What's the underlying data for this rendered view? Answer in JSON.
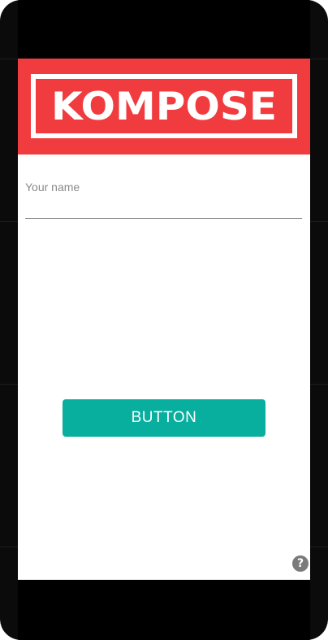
{
  "header": {
    "logo_text": "KOMPOSE",
    "background": "#f03c3e"
  },
  "form": {
    "name_placeholder": "Your name",
    "name_value": ""
  },
  "actions": {
    "button_label": "BUTTON",
    "button_color": "#08ae9e"
  },
  "help": {
    "icon": "help-icon",
    "glyph": "?"
  }
}
